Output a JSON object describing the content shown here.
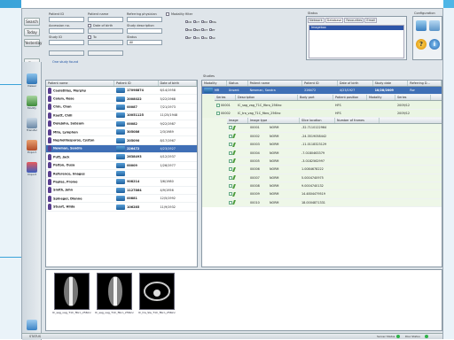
{
  "top_buttons": {
    "search": "Search",
    "today": "Today",
    "yesterday": "Yesterday",
    "clear": "Clear entries"
  },
  "form": {
    "patient_id_label": "Patient ID",
    "patient_name_label": "Patient name",
    "ref_phys_label": "Referring physician",
    "modality_filter_label": "Modality filter",
    "accession_label": "Accession no.",
    "date_birth_label": "Date of birth",
    "study_desc_label": "Study description",
    "study_id_label": "Study ID",
    "to_label": "To",
    "status_label": "Status",
    "status_value": "All",
    "no_study_found": "One study found",
    "modalities": [
      "CR",
      "CT",
      "DX",
      "MG",
      "MR",
      "NM",
      "OT",
      "PT",
      "RF",
      "US",
      "XA",
      "SC"
    ]
  },
  "studies_box": {
    "title": "Status",
    "tabs": [
      "Network",
      "Database",
      "Favourites",
      "Email"
    ],
    "item": "Imagebox"
  },
  "config_label": "Configuration",
  "toolbar": [
    "Viewer",
    "Modify",
    "Transfer",
    "Export",
    "Import"
  ],
  "patient_table": {
    "headers": [
      "Patient name",
      "Patient ID",
      "Date of birth"
    ],
    "rows": [
      {
        "name": "Caulatillas, Murphy",
        "id": "17098874",
        "dob": "6/14/1958"
      },
      {
        "name": "Calum, Rose",
        "id": "2008022",
        "dob": "5/22/1968"
      },
      {
        "name": "Chin, Chan",
        "id": "00087",
        "dob": "7/21/1973"
      },
      {
        "name": "Kautt, Chili",
        "id": "10051125",
        "dob": "11/25/1948"
      },
      {
        "name": "Dulejoho, Subsum",
        "id": "00082",
        "dob": "9/22/1987"
      },
      {
        "name": "Milo, Lymphon",
        "id": "305086",
        "dob": "2/3/1989"
      },
      {
        "name": "Nepholiiosporos, Cyston",
        "id": "205090",
        "dob": "8/17/1967"
      },
      {
        "name": "Newman, Sandra",
        "id": "226472",
        "dob": "4/23/1927"
      },
      {
        "name": "Putt, Jack",
        "id": "2638493",
        "dob": "4/12/1937"
      },
      {
        "name": "Paiton, Ousa",
        "id": "00009",
        "dob": "1/26/1977"
      },
      {
        "name": "Reference, Images",
        "id": "",
        "dob": ""
      },
      {
        "name": "Papias, Promo",
        "id": "908214",
        "dob": "3/6/1980"
      },
      {
        "name": "Smith, John",
        "id": "1127864",
        "dob": "4/9/1956"
      },
      {
        "name": "Spinegel, Dianne",
        "id": "00881",
        "dob": "12/5/1992"
      },
      {
        "name": "Stuart, Hilda",
        "id": "106285",
        "dob": "11/9/1932"
      }
    ]
  },
  "study_table": {
    "title": "Studies",
    "headers": [
      "Modality",
      "Status",
      "Patient name",
      "Patient ID",
      "Date of birth",
      "Study date",
      "Referring D..."
    ],
    "study_row": {
      "mod": "MR",
      "status": "Unsent",
      "name": "Newman, Sandra",
      "id": "226472",
      "dob": "4/23/1927",
      "date": "10/28/2009",
      "ref": "Ror"
    },
    "series_headers": [
      "Series",
      "Description",
      "Body part",
      "Patient position",
      "Modality",
      "Series"
    ],
    "series": [
      {
        "no": "00001",
        "desc": "IC_sag_vag_T1C_fibro_256inc",
        "body": "",
        "pos": "HFS",
        "mod": "",
        "date": "2009/12"
      },
      {
        "no": "00002",
        "desc": "IC_tra_vag_T1C_fibro_256inc",
        "body": "",
        "pos": "HFS",
        "mod": "",
        "date": "2009/12"
      }
    ],
    "image_headers": [
      "Image",
      "Image type",
      "Slice location",
      "Number of frames"
    ],
    "images": [
      {
        "no": "00001",
        "type": "NORM",
        "loc": "-32.7110122964"
      },
      {
        "no": "00002",
        "type": "NORM",
        "loc": "-24.3519058442"
      },
      {
        "no": "00003",
        "type": "NORM",
        "loc": "-11.0118323129"
      },
      {
        "no": "00004",
        "type": "NORM",
        "loc": "-7.0180463379"
      },
      {
        "no": "00005",
        "type": "NORM",
        "loc": "-3.0182562997"
      },
      {
        "no": "00006",
        "type": "NORM",
        "loc": "1.0084678222"
      },
      {
        "no": "00007",
        "type": "NORM",
        "loc": "5.0004740975"
      },
      {
        "no": "00008",
        "type": "NORM",
        "loc": "9.0004740132"
      },
      {
        "no": "00009",
        "type": "NORM",
        "loc": "14.4804479519"
      },
      {
        "no": "00010",
        "type": "NORM",
        "loc": "18.0004871331"
      }
    ]
  },
  "thumbnails": [
    {
      "caption": "IC_sag_vag_T1C_fibro_256inc"
    },
    {
      "caption": "IC_sag_vag_T1C_fibro_256inc"
    },
    {
      "caption": "IC_tra_Sla_T1C_fibro_256inc"
    }
  ],
  "status_bar": {
    "label": "STATUS",
    "server": "Server Status",
    "disc": "Disc Status"
  }
}
